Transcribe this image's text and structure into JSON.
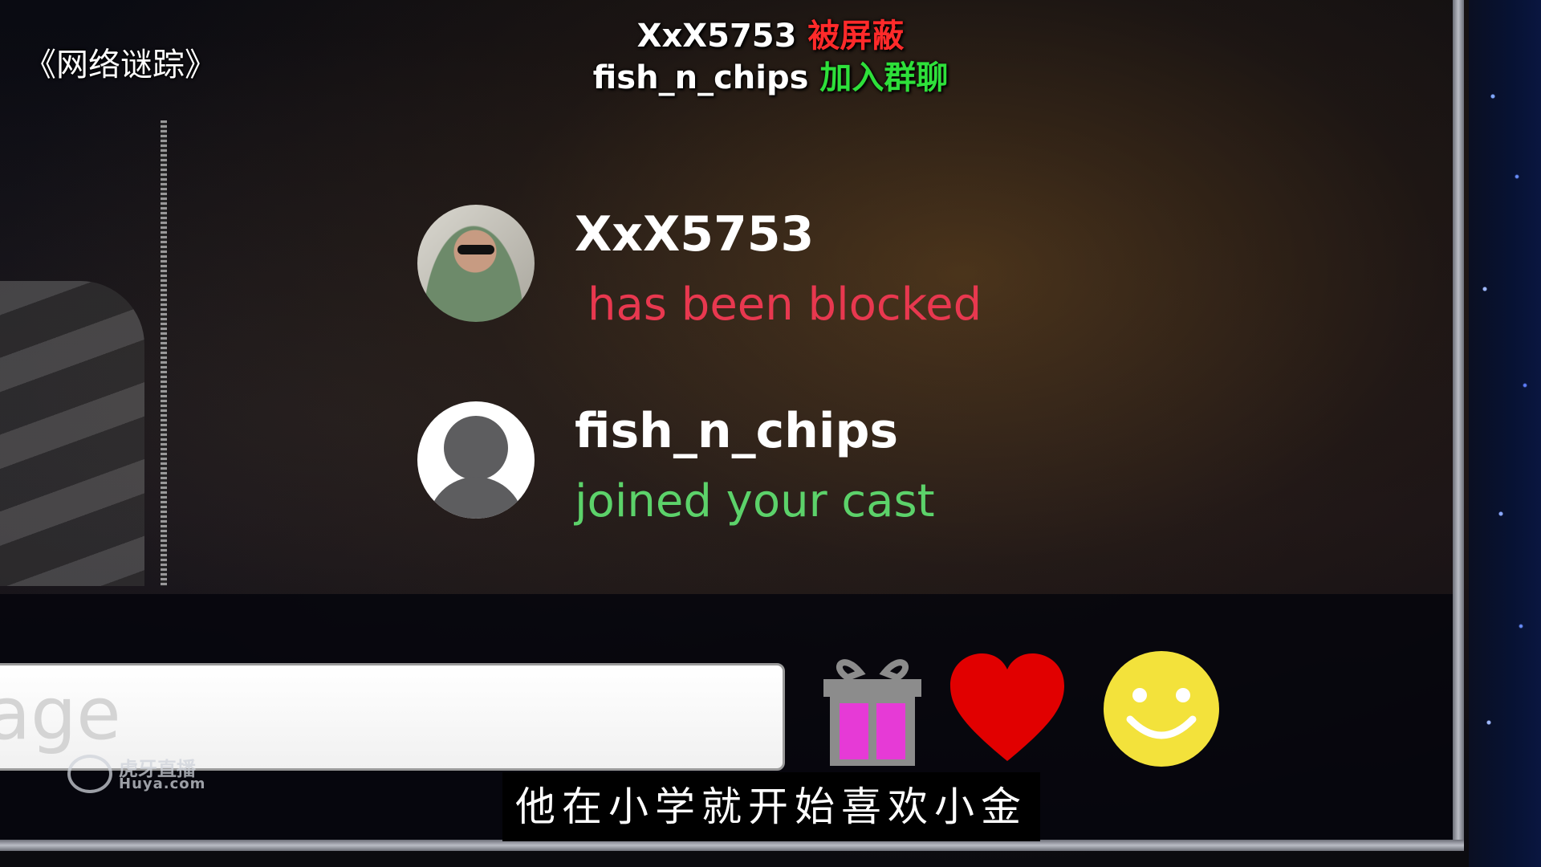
{
  "corner_title": "《网络谜踪》",
  "notices": [
    {
      "name": "XxX5753",
      "status": "被屏蔽",
      "status_color": "#ff2a2a"
    },
    {
      "name": "fish_n_chips",
      "status": "加入群聊",
      "status_color": "#2ee03a"
    }
  ],
  "events": [
    {
      "user": "XxX5753",
      "action": "has been blocked",
      "action_color": "#e8384f",
      "avatar": "photo-avatar"
    },
    {
      "user": "fish_n_chips",
      "action": "joined your cast",
      "action_color": "#5cd26a",
      "avatar": "default-avatar"
    }
  ],
  "message_input": {
    "placeholder": "age"
  },
  "actions": [
    {
      "icon": "gift-icon",
      "color": "#e63ad6"
    },
    {
      "icon": "heart-icon",
      "color": "#e10000"
    },
    {
      "icon": "smiley-icon",
      "color": "#f3e23b"
    }
  ],
  "watermark": {
    "brand": "虎牙直播",
    "domain": "Huya.com"
  },
  "subtitle": "他在小学就开始喜欢小金"
}
